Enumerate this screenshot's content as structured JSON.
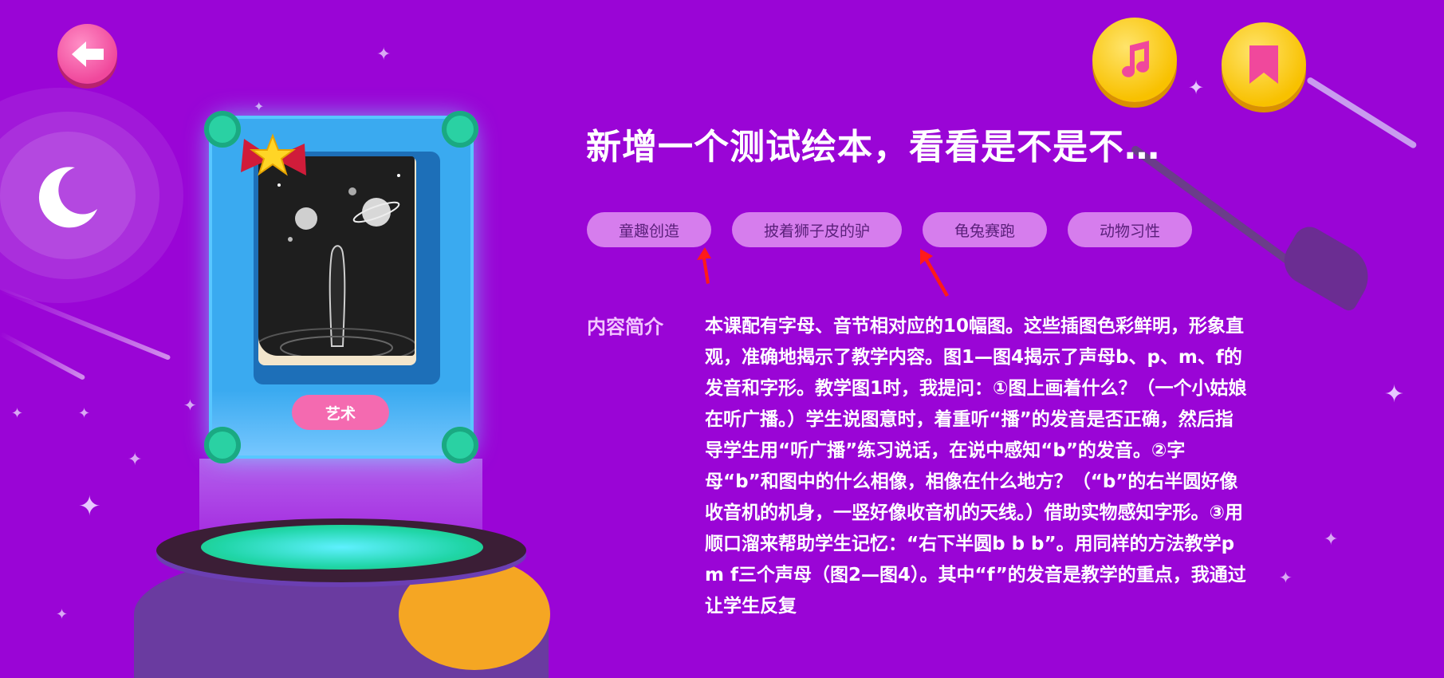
{
  "nav": {
    "back_icon": "back-arrow-icon"
  },
  "actions": {
    "music_icon": "music-note-icon",
    "bookmark_icon": "bookmark-icon"
  },
  "book": {
    "title": "新增一个测试绘本，看看是不是不…",
    "category": "艺术",
    "tags": [
      "童趣创造",
      "披着狮子皮的驴",
      "龟兔赛跑",
      "动物习性"
    ]
  },
  "description": {
    "label": "内容简介",
    "text": "本课配有字母、音节相对应的10幅图。这些插图色彩鲜明，形象直观，准确地揭示了教学内容。图1—图4揭示了声母b、p、m、f的发音和字形。教学图1时，我提问：①图上画着什么？（一个小姑娘在听广播。）学生说图意时，着重听“播”的发音是否正确，然后指导学生用“听广播”练习说话，在说中感知“b”的发音。②字母“b”和图中的什么相像，相像在什么地方？（“b”的右半圆好像收音机的机身，一竖好像收音机的天线。）借助实物感知字形。③用顺口溜来帮助学生记忆：“右下半圆b b b”。用同样的方法教学p m f三个声母（图2—图4）。其中“f”的发音是教学的重点，我通过让学生反复"
  },
  "colors": {
    "background": "#9a05d6",
    "tag_chip": "#d67ded",
    "category_pill": "#f46ab0",
    "card": "#3aaaf0",
    "round_button": "#f8c100",
    "arrow": "#ff1a1a"
  }
}
